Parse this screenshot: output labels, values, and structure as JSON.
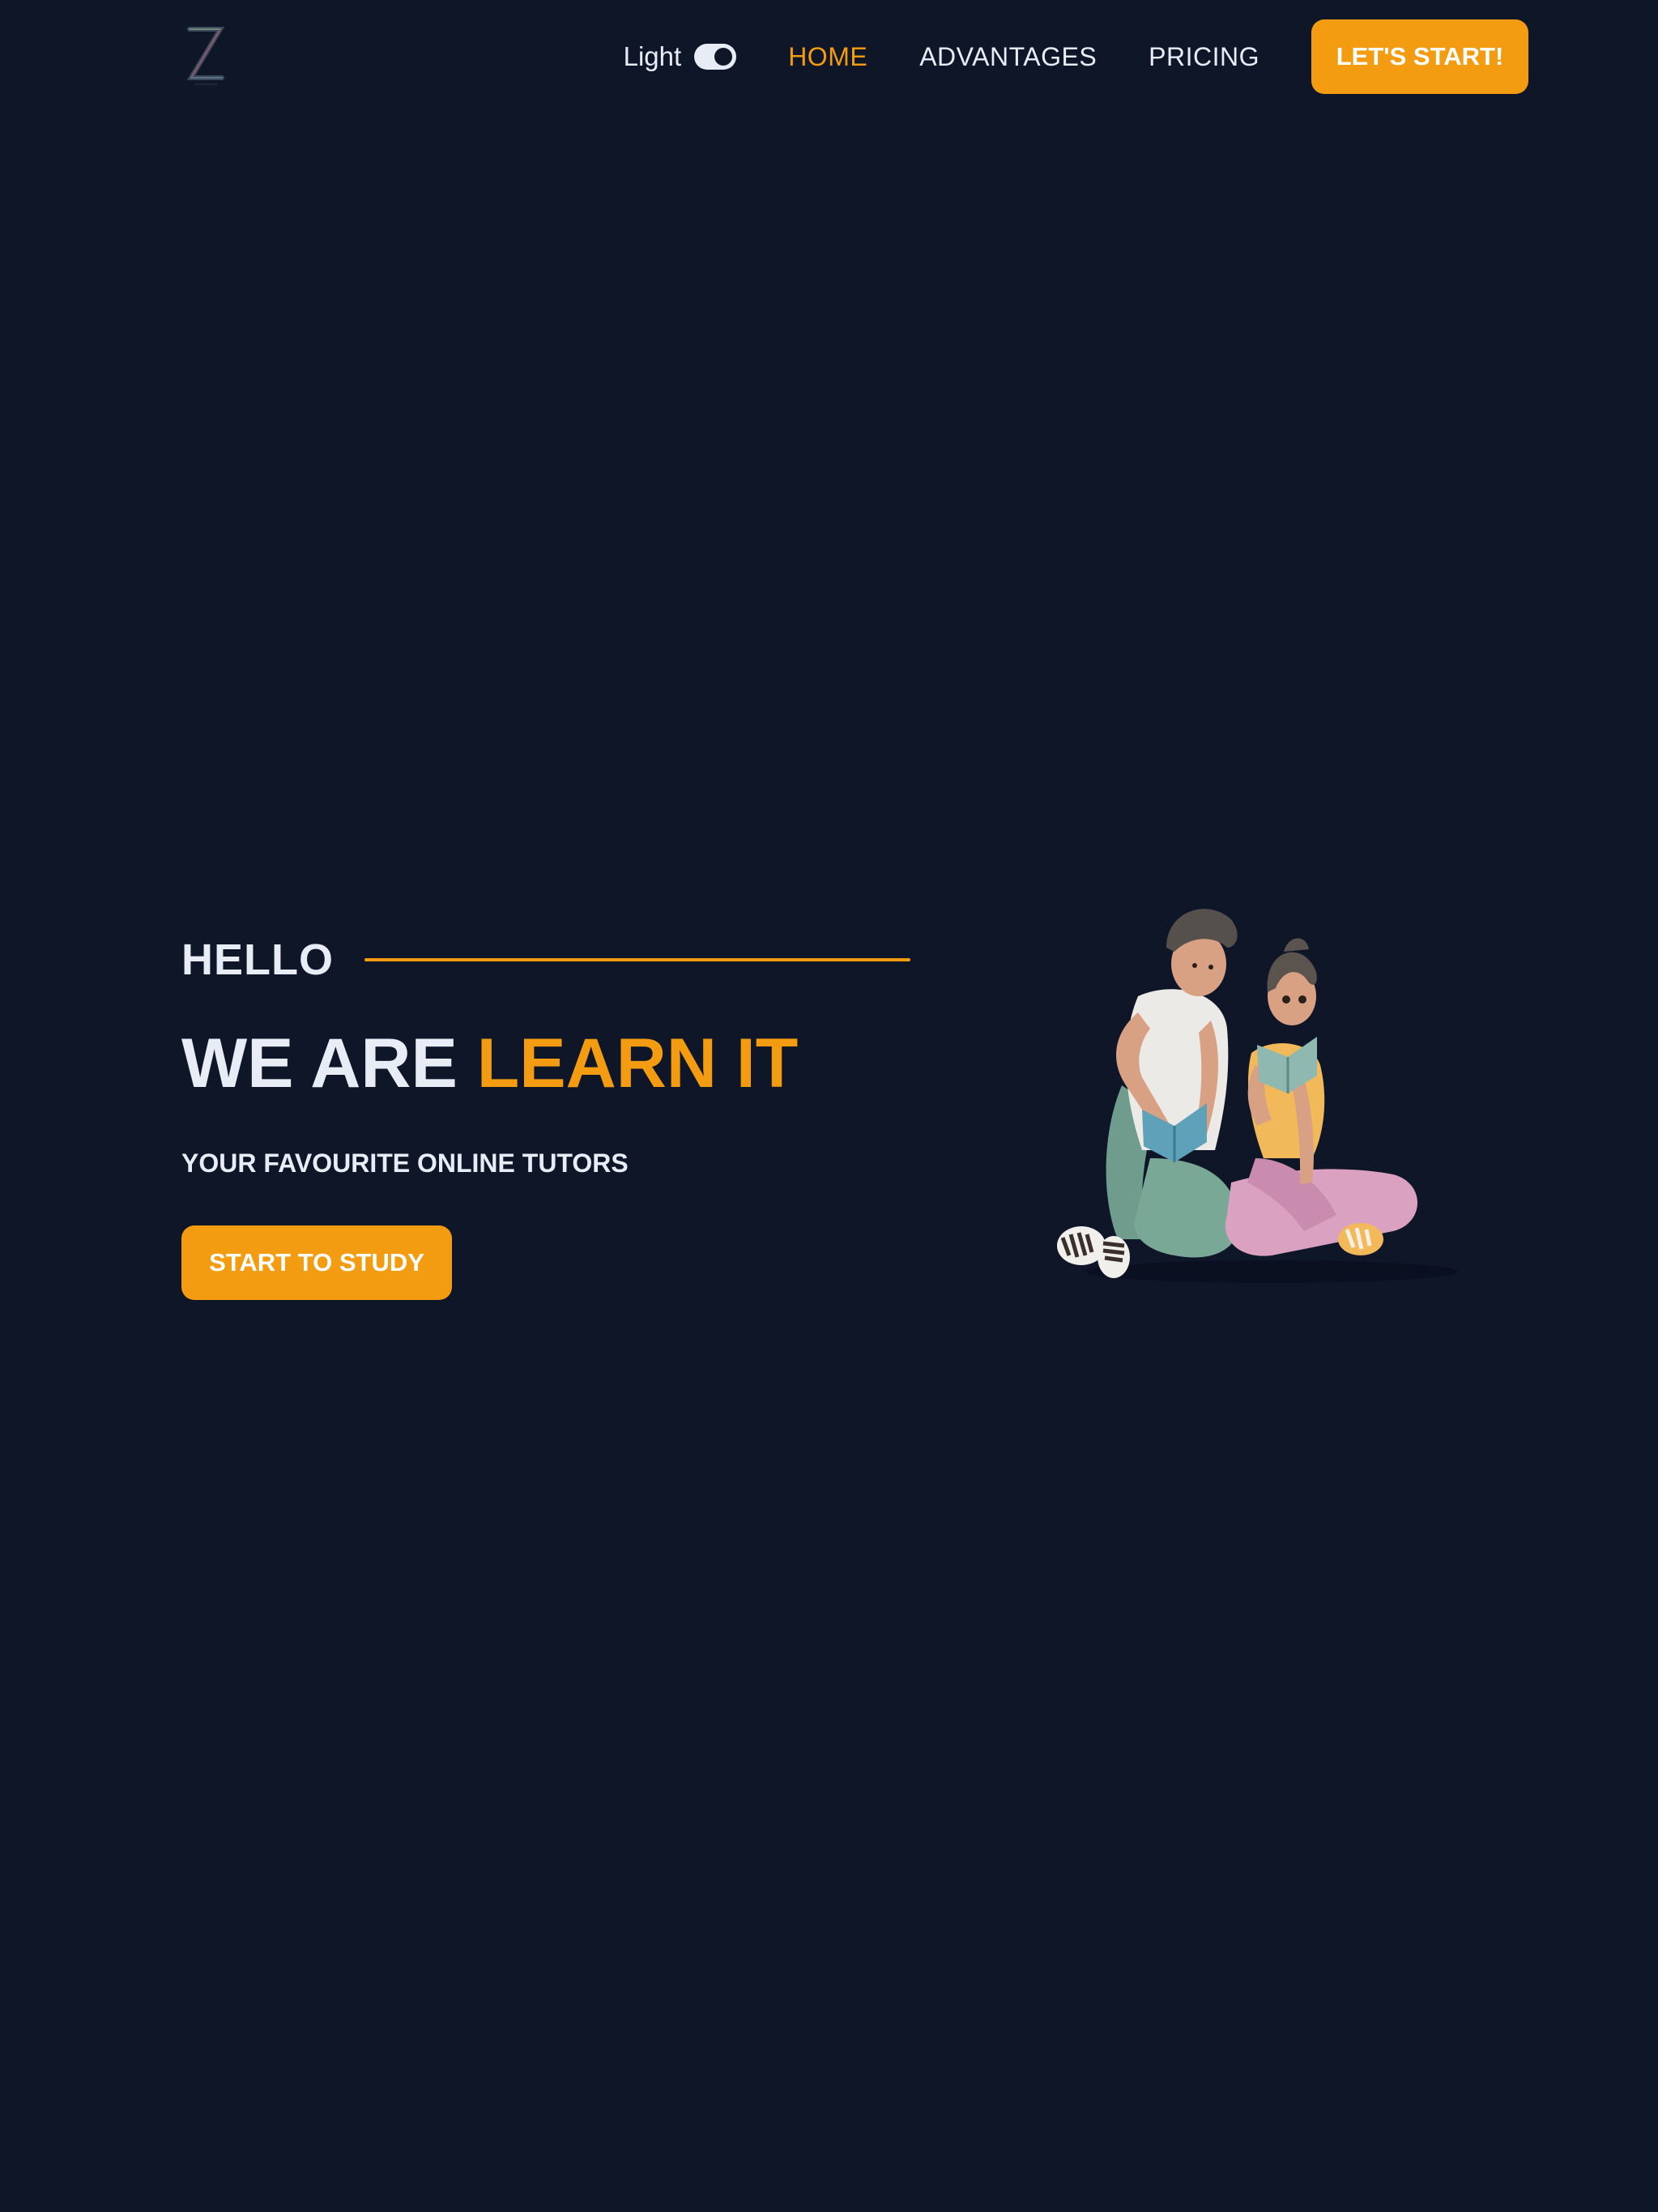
{
  "header": {
    "logo_letter": "Z",
    "theme_label": "Light",
    "nav": {
      "home": "HOME",
      "advantages": "ADVANTAGES",
      "pricing": "PRICING"
    },
    "cta_label": "LET'S START!"
  },
  "hero": {
    "hello": "HELLO",
    "headline_prefix": "WE ARE",
    "headline_accent": "LEARN IT",
    "subtitle": "YOUR FAVOURITE ONLINE TUTORS",
    "cta_label": "START TO STUDY"
  },
  "colors": {
    "background": "#0e1628",
    "accent": "#f39c12",
    "text": "#e7ecf5"
  },
  "icons": {
    "logo": "z-logo-icon",
    "theme_toggle": "toggle-switch-icon",
    "illustration": "students-reading-illustration"
  }
}
